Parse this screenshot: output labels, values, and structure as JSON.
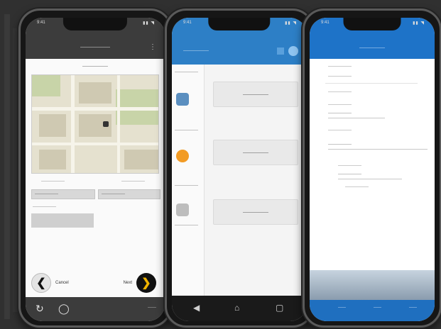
{
  "phones": [
    {
      "status": {
        "time": "9:41",
        "icons": "▮▮ ◥"
      },
      "header": {
        "title": "——————",
        "menu_icon": "⋮"
      },
      "subtitle": "——————",
      "fields": {
        "row_a_left": "——————",
        "row_a_right": "——————",
        "value_left": "——————",
        "value_right": "——————",
        "label_b": "——————"
      },
      "nav": {
        "back_label": "Cancel",
        "next_label": "Next",
        "back_icon": "❮",
        "next_icon": "❯"
      },
      "bottom": {
        "icon_1": "↻",
        "icon_2": "◯",
        "text": "——"
      }
    },
    {
      "status": {
        "time": "9:41",
        "icons": "▮▮ ◥"
      },
      "appbar": {
        "title": "——————"
      },
      "side_labels": [
        "——————",
        "——————",
        "——————",
        "——————"
      ],
      "cards": [
        "——————",
        "——————",
        "——————"
      ],
      "bottom": {
        "back": "◀",
        "home": "⌂",
        "recent": "▢"
      }
    },
    {
      "status": {
        "time": "9:41",
        "icons": "▮▮ ◥"
      },
      "appbar": {
        "title": "——————"
      },
      "lines": [
        "——————",
        "——————",
        "——————",
        "——————",
        "——————",
        "——————",
        "——————"
      ],
      "inputs": [
        "——————",
        "——————",
        "——————"
      ],
      "bottom_tabs": [
        "——",
        "——",
        "——"
      ]
    }
  ],
  "colors": {
    "phone1_header": "#3c3c3c",
    "phone2_accent": "#2d7fc6",
    "phone3_accent": "#1e73c8",
    "next_button": "#f0b400"
  }
}
